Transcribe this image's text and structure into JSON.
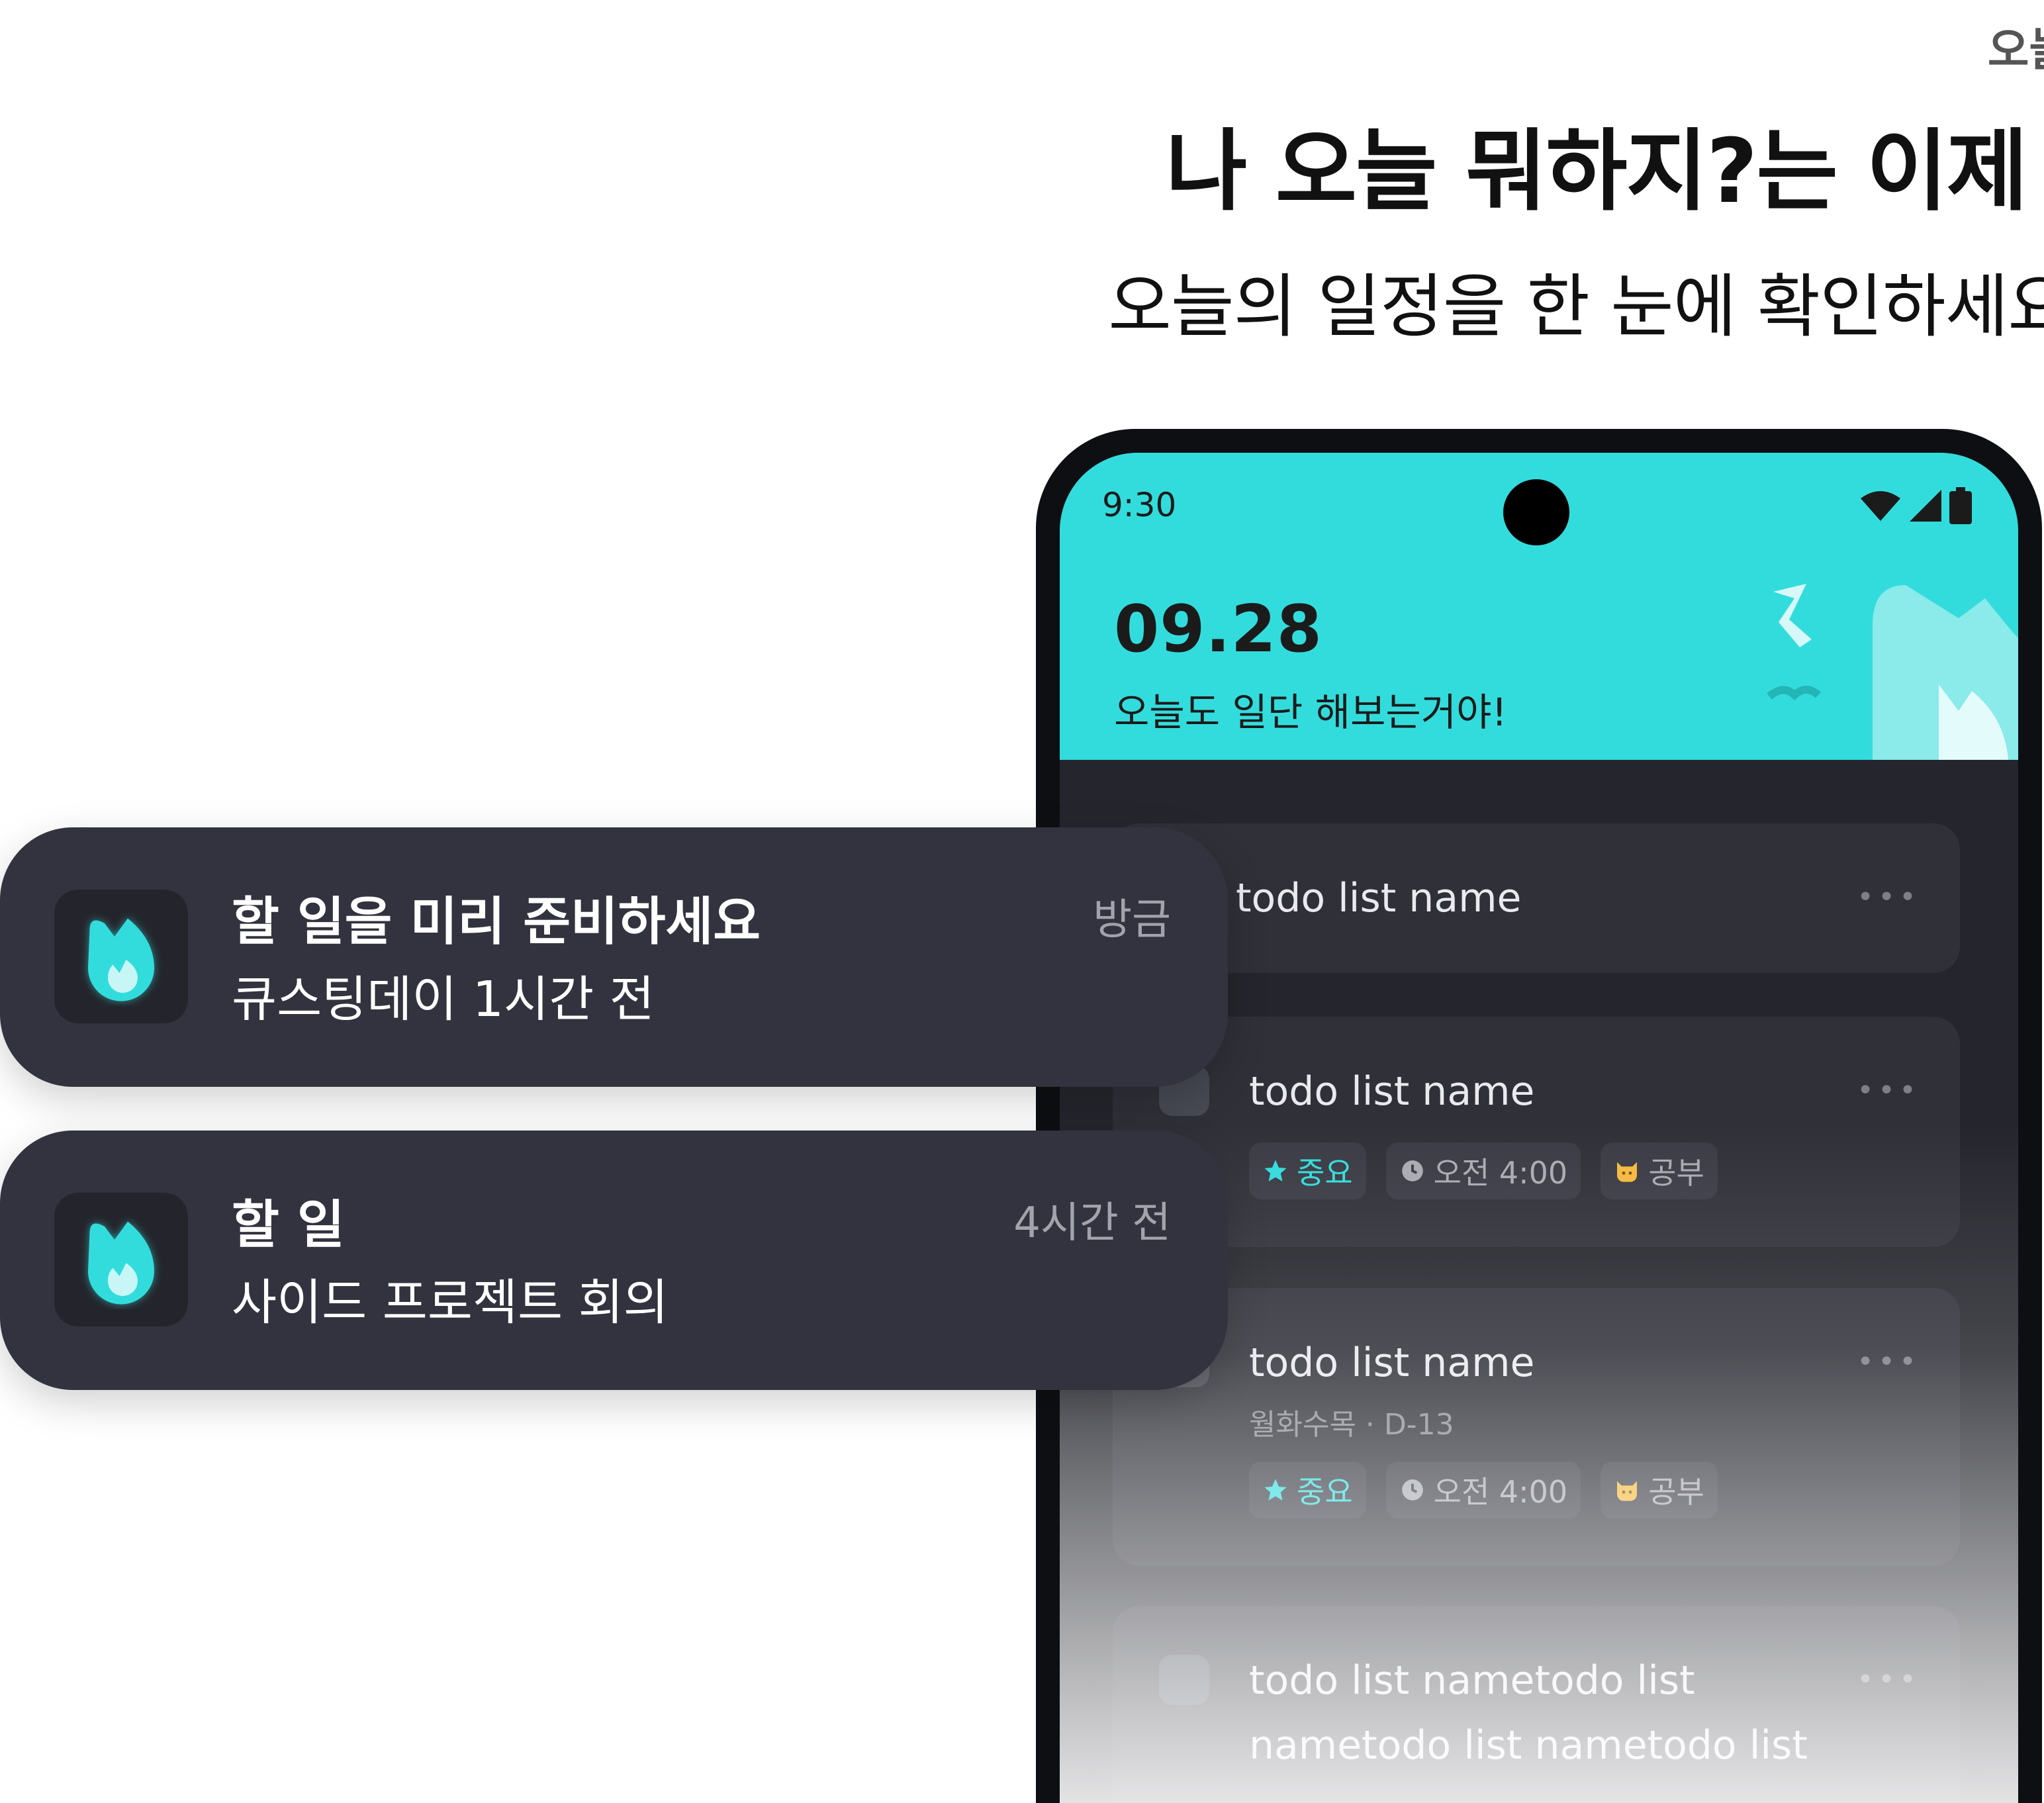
{
  "header": {
    "kicker": "오늘",
    "headline": "나 오늘 뭐하지?는 이제 끝",
    "subhead": "오늘의 일정을 한 눈에 확인하세요"
  },
  "phone": {
    "status_time": "9:30",
    "date": "09.28",
    "tagline": "오늘도 일단 해보는거야!",
    "accent_color": "#33dcdc",
    "todos": [
      {
        "title": "todo list name",
        "more": "•••"
      },
      {
        "title": "todo list name",
        "more": "•••",
        "chips": {
          "priority": "중요",
          "time": "오전 4:00",
          "category": "공부"
        }
      },
      {
        "title": "todo list name",
        "more": "•••",
        "meta": "월화수목 · D-13",
        "chips": {
          "priority": "중요",
          "time": "오전 4:00",
          "category": "공부"
        }
      },
      {
        "title": "todo list nametodo list",
        "title2": "nametodo list nametodo list",
        "more": "•••"
      }
    ],
    "icons": [
      "wifi-icon",
      "signal-icon",
      "battery-icon",
      "star-icon",
      "clock-icon",
      "cat-emoji-icon"
    ]
  },
  "notifications": [
    {
      "title": "할 일을 미리 준비하세요",
      "body": "큐스팅데이 1시간 전",
      "time": "방금",
      "icon": "flame-app-icon"
    },
    {
      "title": "할 일",
      "body": "사이드 프로젝트 회의",
      "time": "4시간 전",
      "icon": "flame-app-icon"
    }
  ]
}
